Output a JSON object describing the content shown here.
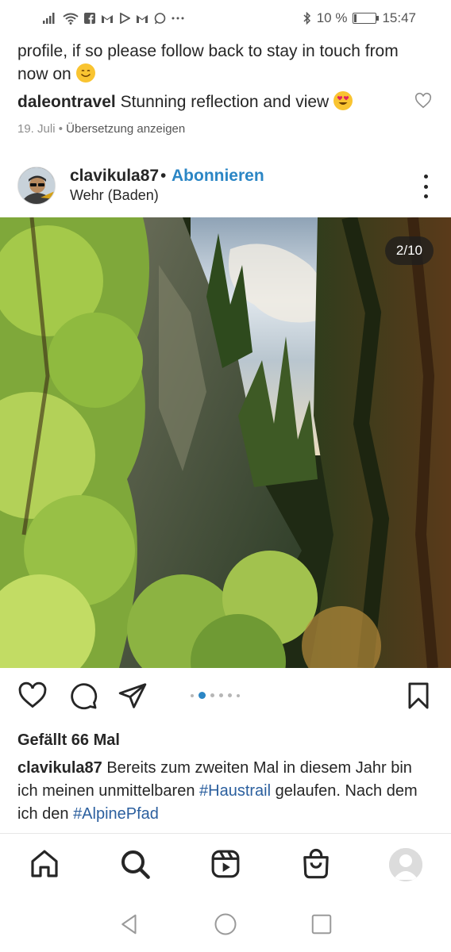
{
  "status_bar": {
    "battery": "10 %",
    "time": "15:47"
  },
  "previous_comments": {
    "caption_text": "profile, if so please follow back to stay in touch from now on",
    "comment_user": "daleontravel",
    "comment_text": "Stunning reflection and view",
    "date": "19. Juli",
    "separator": "•",
    "translate_label": "Übersetzung anzeigen"
  },
  "post": {
    "username": "clavikula87",
    "separator": "•",
    "follow_label": "Abonnieren",
    "location": "Wehr (Baden)",
    "photo_counter": "2/10",
    "carousel": {
      "count": 6,
      "active_index": 1
    },
    "likes": "Gefällt 66 Mal",
    "caption": {
      "username": "clavikula87",
      "text1": "Bereits zum zweiten Mal in diesem Jahr bin ich meinen unmittelbaren",
      "tag1": "#Haustrail",
      "text2": "gelaufen. Nach dem ich den",
      "tag2": "#AlpinePfad"
    }
  },
  "colors": {
    "link_blue": "#2b86c5",
    "hashtag": "#2b5f9e",
    "text": "#262626",
    "muted": "#8e8e8e"
  },
  "bottom_nav": {
    "items": [
      "home-icon",
      "search-icon",
      "reels-icon",
      "shop-icon",
      "profile-avatar"
    ]
  }
}
